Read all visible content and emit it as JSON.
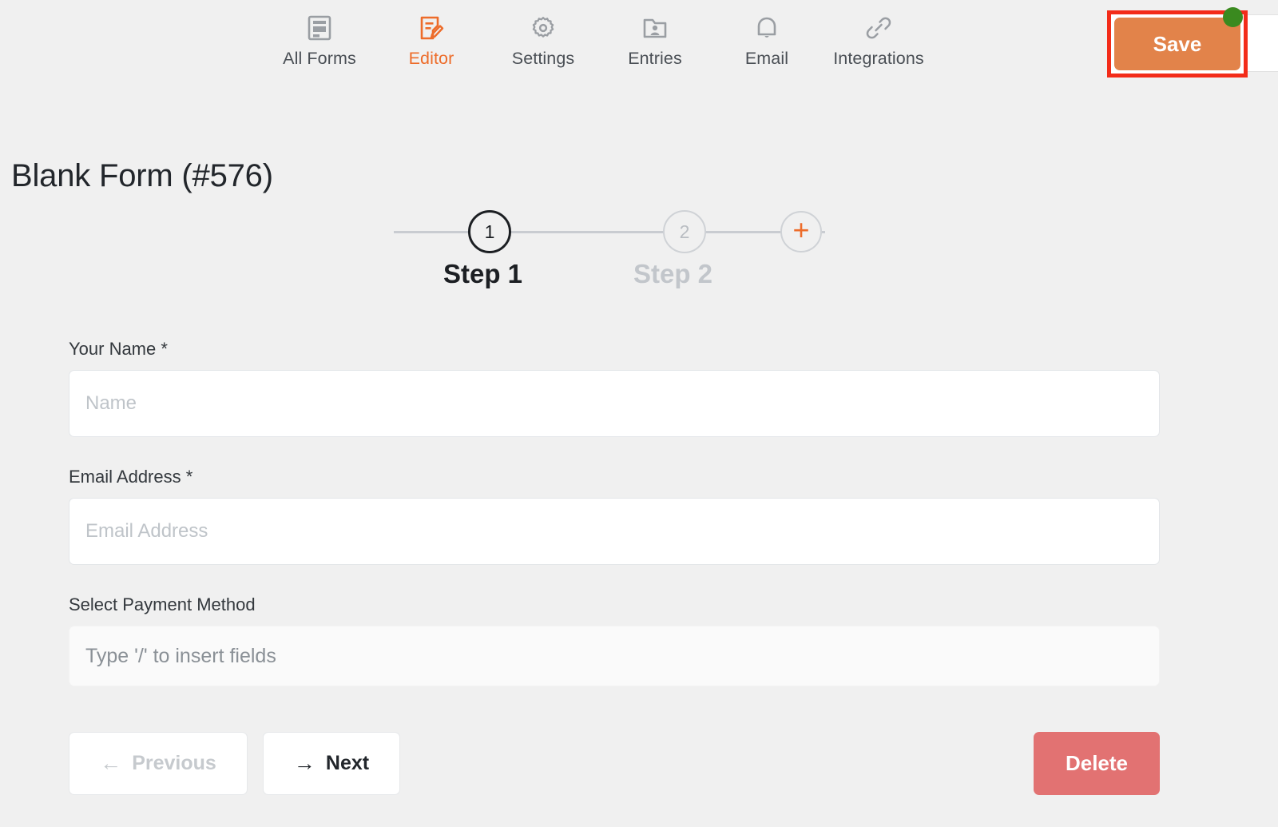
{
  "nav": {
    "items": [
      {
        "label": "All Forms",
        "icon": "form-document-icon",
        "active": false
      },
      {
        "label": "Editor",
        "icon": "document-pencil-icon",
        "active": true
      },
      {
        "label": "Settings",
        "icon": "gear-icon",
        "active": false
      },
      {
        "label": "Entries",
        "icon": "folder-user-icon",
        "active": false
      },
      {
        "label": "Email",
        "icon": "bell-icon",
        "active": false
      },
      {
        "label": "Integrations",
        "icon": "link-chain-icon",
        "active": false
      }
    ],
    "save_label": "Save"
  },
  "page": {
    "title": "Blank Form (#576)"
  },
  "steps": {
    "nodes": [
      {
        "number": "1",
        "label": "Step 1",
        "active": true
      },
      {
        "number": "2",
        "label": "Step 2",
        "active": false
      }
    ],
    "add_label": "+"
  },
  "form": {
    "fields": [
      {
        "label": "Your Name *",
        "placeholder": "Name",
        "value": "",
        "type": "text"
      },
      {
        "label": "Email Address *",
        "placeholder": "Email Address",
        "value": "",
        "type": "text"
      },
      {
        "label": "Select Payment Method",
        "placeholder": "Type '/' to insert fields",
        "value": "",
        "type": "rich"
      }
    ]
  },
  "footer": {
    "previous_label": "Previous",
    "previous_arrow": "←",
    "next_label": "Next",
    "next_arrow": "→",
    "delete_label": "Delete"
  },
  "colors": {
    "accent_orange": "#ed6c2a",
    "save_orange": "#e2834a",
    "delete_red": "#e27272",
    "highlight_red": "#f32c19",
    "status_green": "#3a8a1f",
    "background": "#f0f0f0"
  }
}
